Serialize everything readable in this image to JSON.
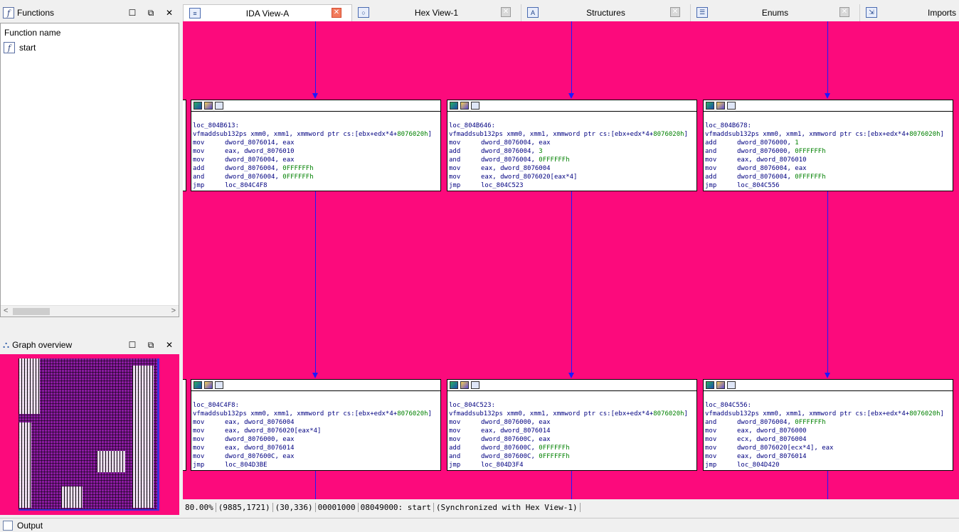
{
  "functions_panel": {
    "title": "Functions",
    "column_header": "Function name",
    "items": [
      {
        "name": "start"
      }
    ]
  },
  "graph_overview": {
    "title": "Graph overview"
  },
  "tabs": [
    {
      "label": "IDA View-A",
      "active": true
    },
    {
      "label": "Hex View-1",
      "active": false
    },
    {
      "label": "Structures",
      "active": false
    },
    {
      "label": "Enums",
      "active": false
    },
    {
      "label": "Imports",
      "active": false
    }
  ],
  "colors": {
    "graph_bg": "#fc0a7c",
    "edge": "#1a1aff",
    "node_text": "#000080",
    "number": "#008000"
  },
  "nodes": [
    {
      "label": "loc_804B613:",
      "lines": [
        {
          "m": "vfmaddsub132ps",
          "o": "xmm0, xmm1, xmmword ptr cs:[ebx+edx*4+",
          "n": "8076020h",
          "s": "]"
        },
        {
          "m": "mov",
          "o": "dword_8076014, eax"
        },
        {
          "m": "mov",
          "o": "eax, dword_8076010"
        },
        {
          "m": "mov",
          "o": "dword_8076004, eax"
        },
        {
          "m": "add",
          "o": "dword_8076004, ",
          "n": "0FFFFFFh"
        },
        {
          "m": "and",
          "o": "dword_8076004, ",
          "n": "0FFFFFFh"
        },
        {
          "m": "jmp",
          "o": "loc_804C4F8"
        }
      ]
    },
    {
      "label": "loc_804B646:",
      "lines": [
        {
          "m": "vfmaddsub132ps",
          "o": "xmm0, xmm1, xmmword ptr cs:[ebx+edx*4+",
          "n": "8076020h",
          "s": "]"
        },
        {
          "m": "mov",
          "o": "dword_8076004, eax"
        },
        {
          "m": "add",
          "o": "dword_8076004, ",
          "n": "3"
        },
        {
          "m": "and",
          "o": "dword_8076004, ",
          "n": "0FFFFFFh"
        },
        {
          "m": "mov",
          "o": "eax, dword_8076004"
        },
        {
          "m": "mov",
          "o": "eax, dword_8076020[eax*4]"
        },
        {
          "m": "jmp",
          "o": "loc_804C523"
        }
      ]
    },
    {
      "label": "loc_804B678:",
      "lines": [
        {
          "m": "vfmaddsub132ps",
          "o": "xmm0, xmm1, xmmword ptr cs:[ebx+edx*4+",
          "n": "8076020h",
          "s": "]"
        },
        {
          "m": "add",
          "o": "dword_8076000, ",
          "n": "1"
        },
        {
          "m": "and",
          "o": "dword_8076000, ",
          "n": "0FFFFFFh"
        },
        {
          "m": "mov",
          "o": "eax, dword_8076010"
        },
        {
          "m": "mov",
          "o": "dword_8076004, eax"
        },
        {
          "m": "add",
          "o": "dword_8076004, ",
          "n": "0FFFFFFh"
        },
        {
          "m": "jmp",
          "o": "loc_804C556"
        }
      ]
    },
    {
      "label": "loc_804C4F8:",
      "lines": [
        {
          "m": "vfmaddsub132ps",
          "o": "xmm0, xmm1, xmmword ptr cs:[ebx+edx*4+",
          "n": "8076020h",
          "s": "]"
        },
        {
          "m": "mov",
          "o": "eax, dword_8076004"
        },
        {
          "m": "mov",
          "o": "eax, dword_8076020[eax*4]"
        },
        {
          "m": "mov",
          "o": "dword_8076000, eax"
        },
        {
          "m": "mov",
          "o": "eax, dword_8076014"
        },
        {
          "m": "mov",
          "o": "dword_807600C, eax"
        },
        {
          "m": "jmp",
          "o": "loc_804D3BE"
        }
      ]
    },
    {
      "label": "loc_804C523:",
      "lines": [
        {
          "m": "vfmaddsub132ps",
          "o": "xmm0, xmm1, xmmword ptr cs:[ebx+edx*4+",
          "n": "8076020h",
          "s": "]"
        },
        {
          "m": "mov",
          "o": "dword_8076000, eax"
        },
        {
          "m": "mov",
          "o": "eax, dword_8076014"
        },
        {
          "m": "mov",
          "o": "dword_807600C, eax"
        },
        {
          "m": "add",
          "o": "dword_807600C, ",
          "n": "0FFFFFFh"
        },
        {
          "m": "and",
          "o": "dword_807600C, ",
          "n": "0FFFFFFh"
        },
        {
          "m": "jmp",
          "o": "loc_804D3F4"
        }
      ]
    },
    {
      "label": "loc_804C556:",
      "lines": [
        {
          "m": "vfmaddsub132ps",
          "o": "xmm0, xmm1, xmmword ptr cs:[ebx+edx*4+",
          "n": "8076020h",
          "s": "]"
        },
        {
          "m": "and",
          "o": "dword_8076004, ",
          "n": "0FFFFFFh"
        },
        {
          "m": "mov",
          "o": "eax, dword_8076000"
        },
        {
          "m": "mov",
          "o": "ecx, dword_8076004"
        },
        {
          "m": "mov",
          "o": "dword_8076020[ecx*4], eax"
        },
        {
          "m": "mov",
          "o": "eax, dword_8076014"
        },
        {
          "m": "jmp",
          "o": "loc_804D420"
        }
      ]
    }
  ],
  "status": {
    "zoom": "80.00%",
    "coords": "(9885,1721)",
    "pos": "(30,336)",
    "offset": "00001000",
    "location": "08049000: start",
    "sync": "(Synchronized with Hex View-1)"
  },
  "output": {
    "title": "Output"
  }
}
